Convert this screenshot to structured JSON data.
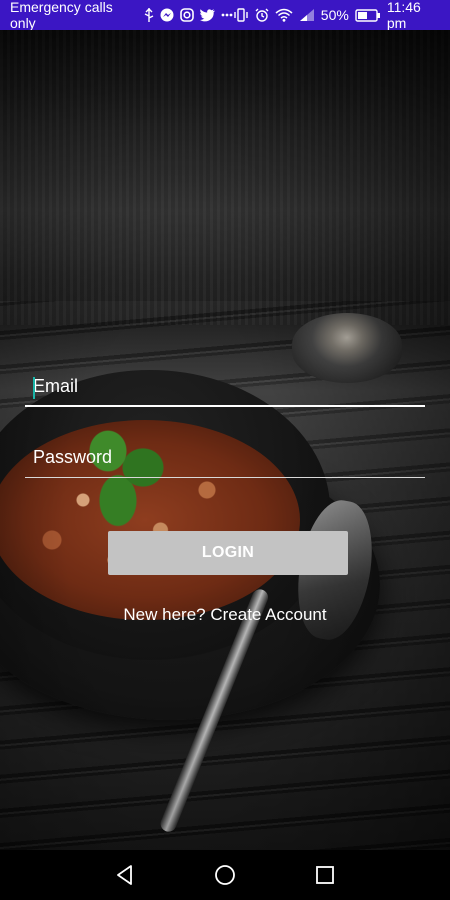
{
  "status_bar": {
    "carrier_text": "Emergency calls only",
    "battery_percent": "50%",
    "time": "11:46 pm",
    "background_color": "#3b16c4",
    "icons": [
      "usb-icon",
      "messenger-icon",
      "instagram-icon",
      "twitter-icon",
      "more-dots-icon",
      "vibrate-icon",
      "alarm-icon",
      "wifi-icon",
      "signal-icon",
      "battery-icon"
    ]
  },
  "login_form": {
    "email_placeholder": "Email",
    "password_placeholder": "Password",
    "login_label": "LOGIN",
    "create_account_label": "New here? Create Account",
    "login_button_color": "#c3c3c3",
    "caret_color": "#19b5a8"
  },
  "nav_bar": {
    "icons": [
      "back-icon",
      "home-icon",
      "recents-icon"
    ]
  }
}
